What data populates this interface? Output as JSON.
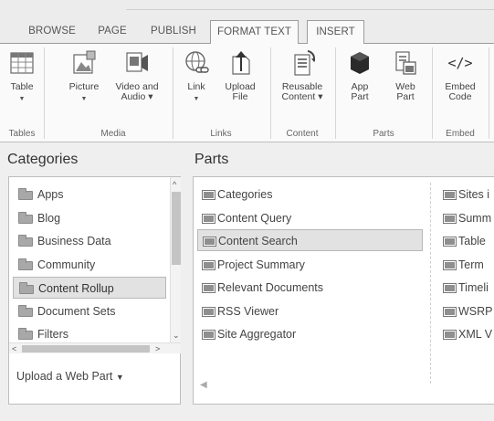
{
  "tabs": [
    "BROWSE",
    "PAGE",
    "PUBLISH",
    "FORMAT TEXT",
    "INSERT"
  ],
  "active_tab": "INSERT",
  "ribbon": {
    "buttons": {
      "table": "Table",
      "picture": "Picture",
      "video_line1": "Video and",
      "video_line2": "Audio",
      "link": "Link",
      "upload_line1": "Upload",
      "upload_line2": "File",
      "reusable_line1": "Reusable",
      "reusable_line2": "Content",
      "app_line1": "App",
      "app_line2": "Part",
      "web_line1": "Web",
      "web_line2": "Part",
      "embed_line1": "Embed",
      "embed_line2": "Code"
    },
    "groups": {
      "tables": "Tables",
      "media": "Media",
      "links": "Links",
      "content": "Content",
      "parts": "Parts",
      "embed": "Embed"
    },
    "embed_glyph": "</>"
  },
  "categories": {
    "heading": "Categories",
    "items": [
      "Apps",
      "Blog",
      "Business Data",
      "Community",
      "Content Rollup",
      "Document Sets",
      "Filters"
    ],
    "selected": "Content Rollup",
    "upload_link": "Upload a Web Part"
  },
  "parts": {
    "heading": "Parts",
    "column1": [
      "Categories",
      "Content Query",
      "Content Search",
      "Project Summary",
      "Relevant Documents",
      "RSS Viewer",
      "Site Aggregator"
    ],
    "column2": [
      "Sites i",
      "Summ",
      "Table",
      "Term",
      "Timeli",
      "WSRP",
      "XML V"
    ],
    "selected": "Content Search"
  }
}
